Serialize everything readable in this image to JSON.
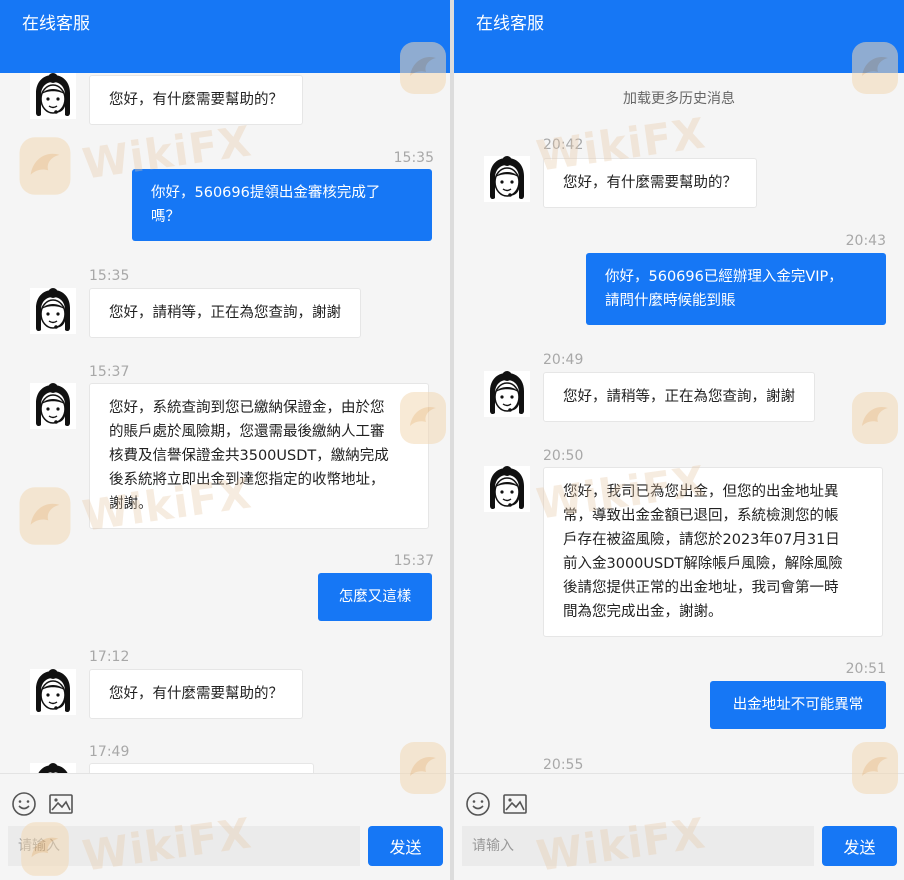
{
  "app": {
    "title": "在线客服"
  },
  "colors": {
    "brand": "#1677f5",
    "incoming_bg": "#ffffff",
    "page_bg": "#f5f5f5",
    "timestamp": "#a8a8a8"
  },
  "watermark": {
    "text": "WikiFX"
  },
  "left": {
    "messages": [
      {
        "from": "agent",
        "text": "您好，有什麼需要幫助的？"
      },
      {
        "time": "15:35",
        "from": "user",
        "lines": [
          "你好，560696提領出金審核完成了",
          "嗎？"
        ]
      },
      {
        "time": "15:35",
        "from": "agent",
        "text": "您好，請稍等，正在為您查詢，謝謝"
      },
      {
        "time": "15:37",
        "from": "agent",
        "lines": [
          "您好，系統查詢到您已繳納保證金，由於您",
          "的賬戶處於風險期，您還需最後繳納人工審",
          "核費及信譽保證金共3500USDT，繳納完成",
          "後系統將立即出金到達您指定的收幣地址，",
          "謝謝。"
        ]
      },
      {
        "time": "15:37",
        "from": "user",
        "text": "怎麼又這樣"
      },
      {
        "time": "17:12",
        "from": "agent",
        "text": "您好，有什麼需要幫助的？"
      },
      {
        "time": "17:49",
        "from": "agent",
        "text": ""
      }
    ]
  },
  "right": {
    "load_more": "加载更多历史消息",
    "messages": [
      {
        "time": "20:42",
        "from": "agent",
        "text": "您好，有什麼需要幫助的？"
      },
      {
        "time": "20:43",
        "from": "user",
        "lines": [
          "你好，560696已經辦理入金完VIP，",
          "請問什麼時候能到賬"
        ]
      },
      {
        "time": "20:49",
        "from": "agent",
        "text": "您好，請稍等，正在為您查詢，謝謝"
      },
      {
        "time": "20:50",
        "from": "agent",
        "lines": [
          "您好，我司已為您出金，但您的出金地址異",
          "常，導致出金金額已退回，系統檢測您的帳",
          "戶存在被盜風險，請您於2023年07月31日",
          "前入金3000USDT解除帳戶風險，解除風險",
          "後請您提供正常的出金地址，我司會第一時",
          "間為您完成出金，謝謝。"
        ]
      },
      {
        "time": "20:51",
        "from": "user",
        "text": "出金地址不可能異常"
      },
      {
        "time": "20:55",
        "from": "agent",
        "text": ""
      }
    ]
  },
  "composer": {
    "emoji_icon": "smiley-icon",
    "image_icon": "image-icon",
    "placeholder": "请输入",
    "send_label": "发送"
  }
}
